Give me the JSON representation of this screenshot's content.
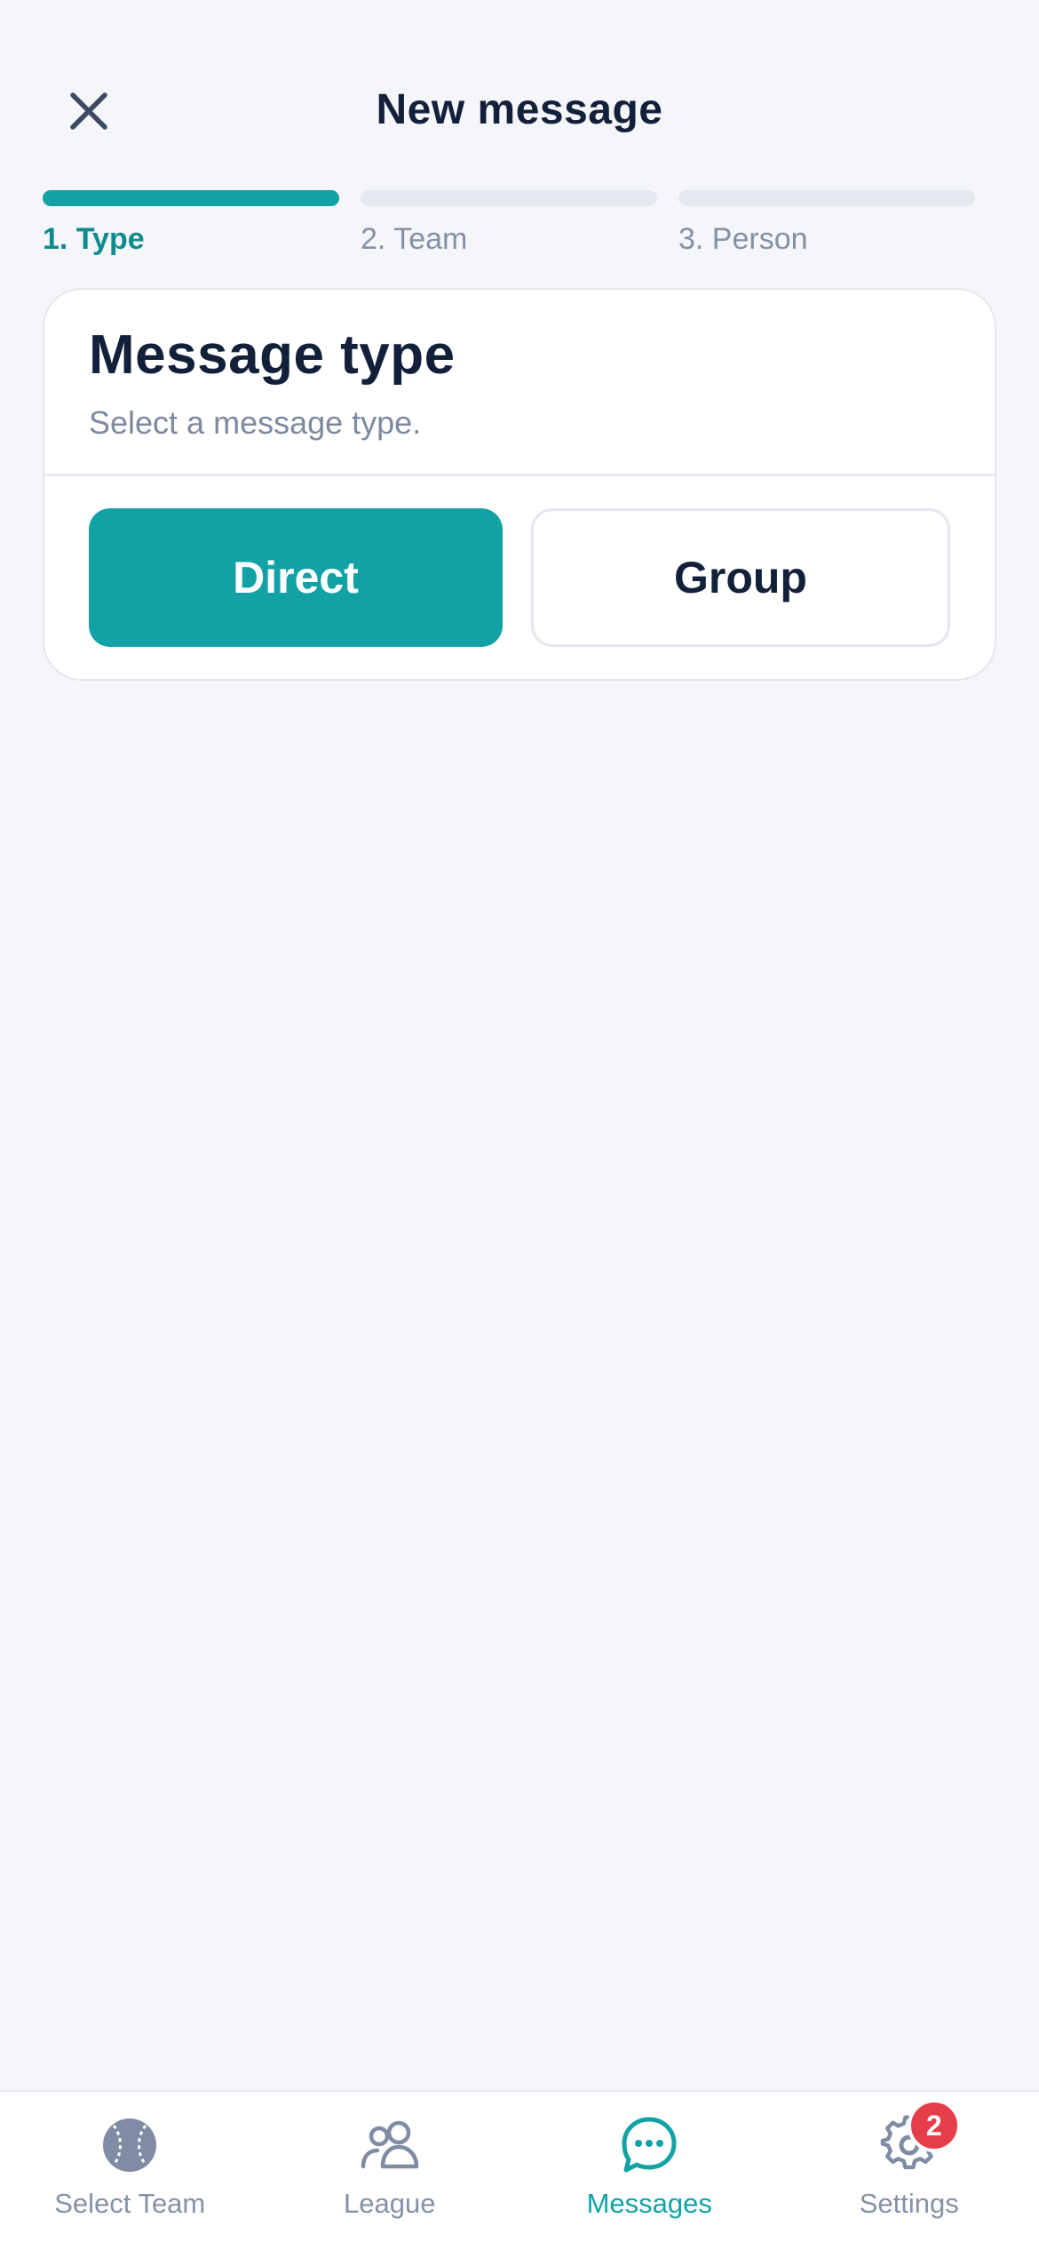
{
  "header": {
    "title": "New message"
  },
  "stepper": {
    "steps": [
      {
        "label": "1. Type",
        "active": true
      },
      {
        "label": "2. Team",
        "active": false
      },
      {
        "label": "3. Person",
        "active": false
      }
    ]
  },
  "card": {
    "title": "Message type",
    "subtitle": "Select a message type.",
    "options": [
      {
        "label": "Direct",
        "selected": true
      },
      {
        "label": "Group",
        "selected": false
      }
    ]
  },
  "tabbar": {
    "tabs": [
      {
        "label": "Select Team",
        "icon": "baseball-icon",
        "active": false
      },
      {
        "label": "League",
        "icon": "users-icon",
        "active": false
      },
      {
        "label": "Messages",
        "icon": "chat-bubble-icon",
        "active": true
      },
      {
        "label": "Settings",
        "icon": "gear-icon",
        "active": false,
        "badge": "2"
      }
    ]
  },
  "colors": {
    "accent": "#12a2a6",
    "text_primary": "#13203a",
    "text_muted": "#8491a7",
    "badge": "#e53e4a",
    "background": "#f5f6fa"
  }
}
